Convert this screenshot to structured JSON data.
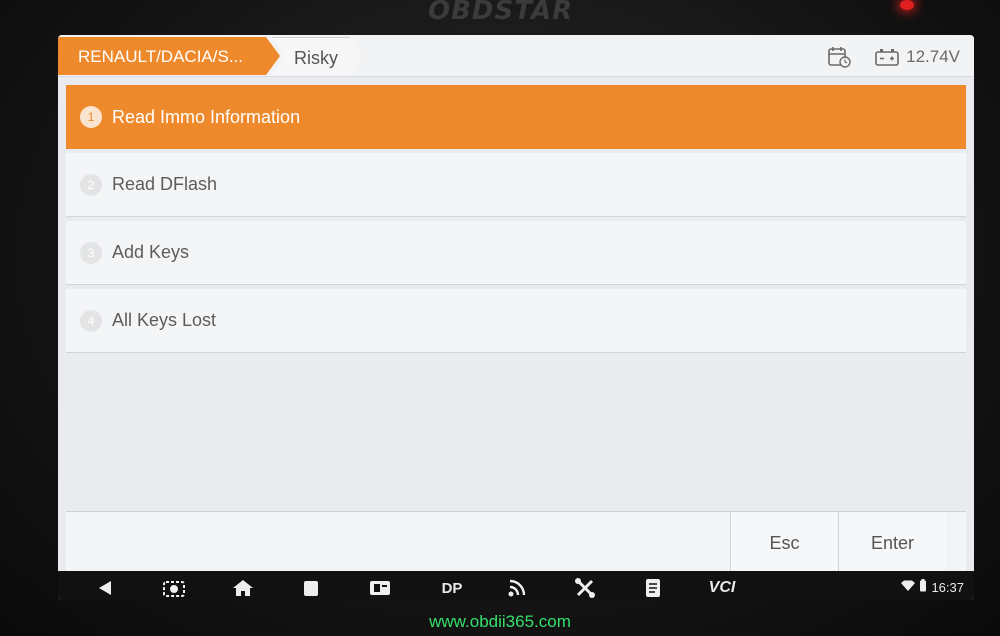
{
  "device": {
    "brand": "OBDSTAR"
  },
  "tabs": {
    "brand_label": "RENAULT/DACIA/S...",
    "current_label": "Risky"
  },
  "status": {
    "voltage": "12.74V"
  },
  "menu": {
    "items": [
      {
        "number": "1",
        "label": "Read Immo Information",
        "selected": true
      },
      {
        "number": "2",
        "label": "Read DFlash",
        "selected": false
      },
      {
        "number": "3",
        "label": "Add Keys",
        "selected": false
      },
      {
        "number": "4",
        "label": "All Keys Lost",
        "selected": false
      }
    ]
  },
  "footer": {
    "esc_label": "Esc",
    "enter_label": "Enter"
  },
  "navbar": {
    "icons": [
      "back-icon",
      "screenshot-icon",
      "home-icon",
      "recent-apps-icon",
      "vci-card-icon",
      "dp-icon",
      "signal-icon",
      "tools-icon",
      "notes-icon",
      "vci-icon"
    ],
    "dp_text": "DP",
    "vci_text": "VCI",
    "time": "16:37"
  },
  "watermark": {
    "text": "www.obdii365.com"
  },
  "colors": {
    "accent": "#ef8a2c",
    "watermark": "#35e06a"
  }
}
